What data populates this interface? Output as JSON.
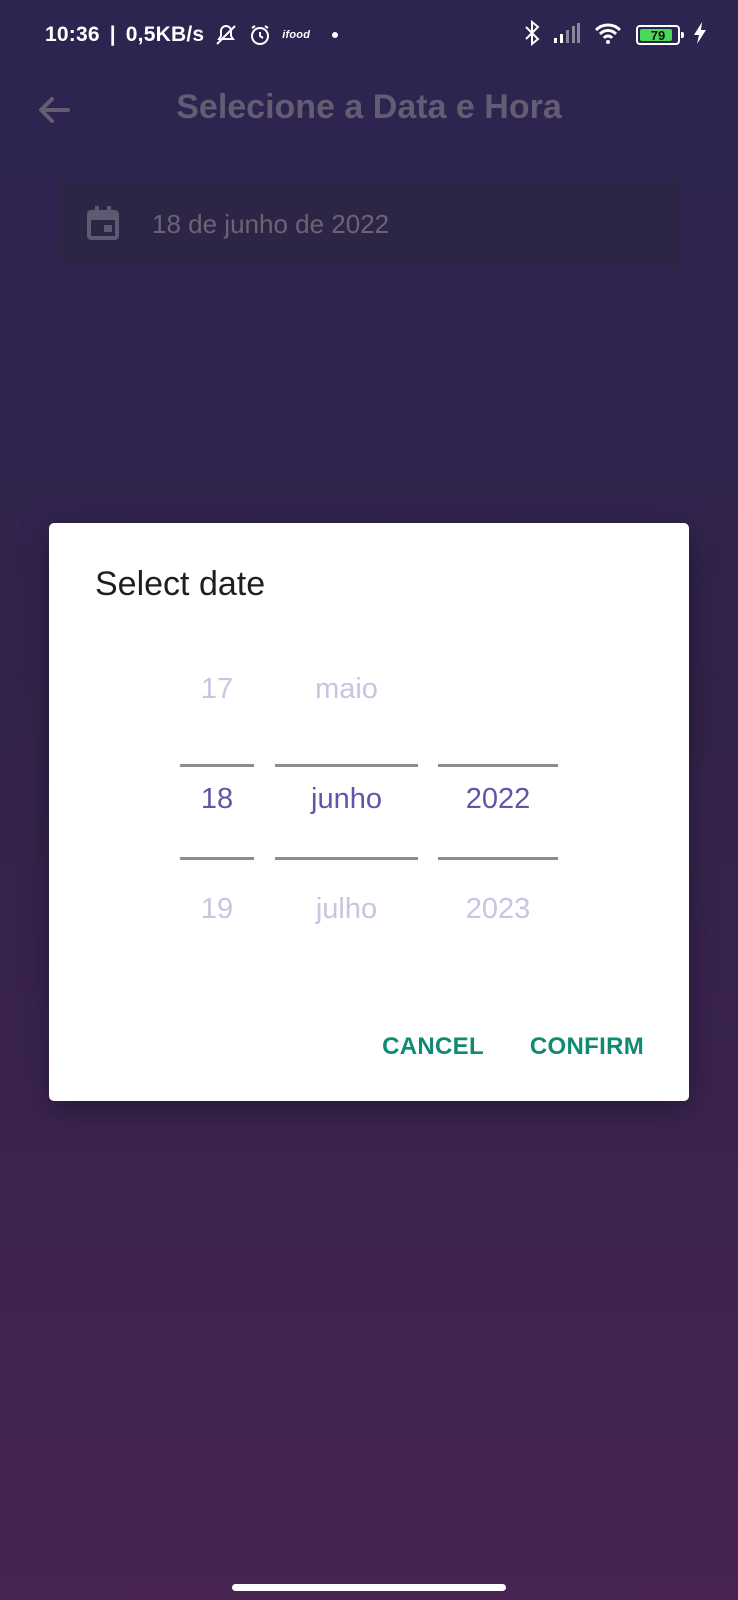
{
  "status_bar": {
    "time": "10:36",
    "speed": "0,5KB/s",
    "ifood_label": "ifood",
    "battery_percent": "79",
    "icons": [
      "bell-off-icon",
      "alarm-icon",
      "ifood-icon",
      "bluetooth-icon",
      "signal-icon",
      "wifi-icon",
      "battery-icon",
      "charging-icon"
    ]
  },
  "app_bar": {
    "title": "Selecione a Data e Hora",
    "back_icon": "arrow-left-icon"
  },
  "date_field": {
    "icon": "calendar-icon",
    "value": "18 de junho de 2022"
  },
  "dialog": {
    "title": "Select date",
    "day": {
      "prev": "17",
      "selected": "18",
      "next": "19"
    },
    "month": {
      "prev": "maio",
      "selected": "junho",
      "next": "julho"
    },
    "year": {
      "prev": "",
      "selected": "2022",
      "next": "2023"
    },
    "cancel_label": "CANCEL",
    "confirm_label": "CONFIRM"
  },
  "colors": {
    "accent": "#0f8a73",
    "picker_selected": "#6454a8",
    "picker_faded": "#c9c4e0"
  }
}
